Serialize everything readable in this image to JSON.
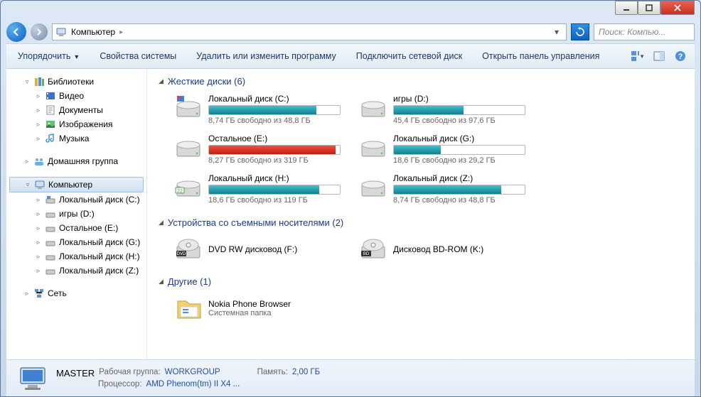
{
  "address": {
    "location": "Компьютер",
    "separator": "▸"
  },
  "search": {
    "placeholder": "Поиск: Компью..."
  },
  "toolbar": {
    "organize": "Упорядочить",
    "properties": "Свойства системы",
    "uninstall": "Удалить или изменить программу",
    "mapdrive": "Подключить сетевой диск",
    "controlpanel": "Открыть панель управления"
  },
  "sidebar": {
    "libraries": "Библиотеки",
    "video": "Видео",
    "documents": "Документы",
    "pictures": "Изображения",
    "music": "Музыка",
    "homegroup": "Домашняя группа",
    "computer": "Компьютер",
    "disk_c": "Локальный диск (C:)",
    "disk_d": "игры (D:)",
    "disk_e": "Остальное (E:)",
    "disk_g": "Локальный диск (G:)",
    "disk_h": "Локальный диск (H:)",
    "disk_z": "Локальный диск (Z:)",
    "network": "Сеть"
  },
  "sections": {
    "hdd": "Жесткие диски (6)",
    "removable": "Устройства со съемными носителями (2)",
    "other": "Другие (1)"
  },
  "drives": [
    {
      "name": "Локальный диск (C:)",
      "status": "8,74 ГБ свободно из 48,8 ГБ",
      "fill": 82,
      "color": "teal"
    },
    {
      "name": "игры (D:)",
      "status": "45,4 ГБ свободно из 97,6 ГБ",
      "fill": 53,
      "color": "teal"
    },
    {
      "name": "Остальное (E:)",
      "status": "8,27 ГБ свободно из 319 ГБ",
      "fill": 97,
      "color": "red"
    },
    {
      "name": "Локальный диск (G:)",
      "status": "18,6 ГБ свободно из 29,2 ГБ",
      "fill": 36,
      "color": "teal"
    },
    {
      "name": "Локальный диск (H:)",
      "status": "18,6 ГБ свободно из 119 ГБ",
      "fill": 84,
      "color": "teal"
    },
    {
      "name": "Локальный диск (Z:)",
      "status": "8,74 ГБ свободно из 48,8 ГБ",
      "fill": 82,
      "color": "teal"
    }
  ],
  "removable": [
    {
      "name": "DVD RW дисковод (F:)",
      "badge": "DVD"
    },
    {
      "name": "Дисковод BD-ROM (K:)",
      "badge": "BD"
    }
  ],
  "other": [
    {
      "name": "Nokia Phone Browser",
      "sub": "Системная папка"
    }
  ],
  "details": {
    "name": "MASTER",
    "workgroup_label": "Рабочая группа:",
    "workgroup": "WORKGROUP",
    "memory_label": "Память:",
    "memory": "2,00 ГБ",
    "processor_label": "Процессор:",
    "processor": "AMD Phenom(tm) II X4 ..."
  }
}
